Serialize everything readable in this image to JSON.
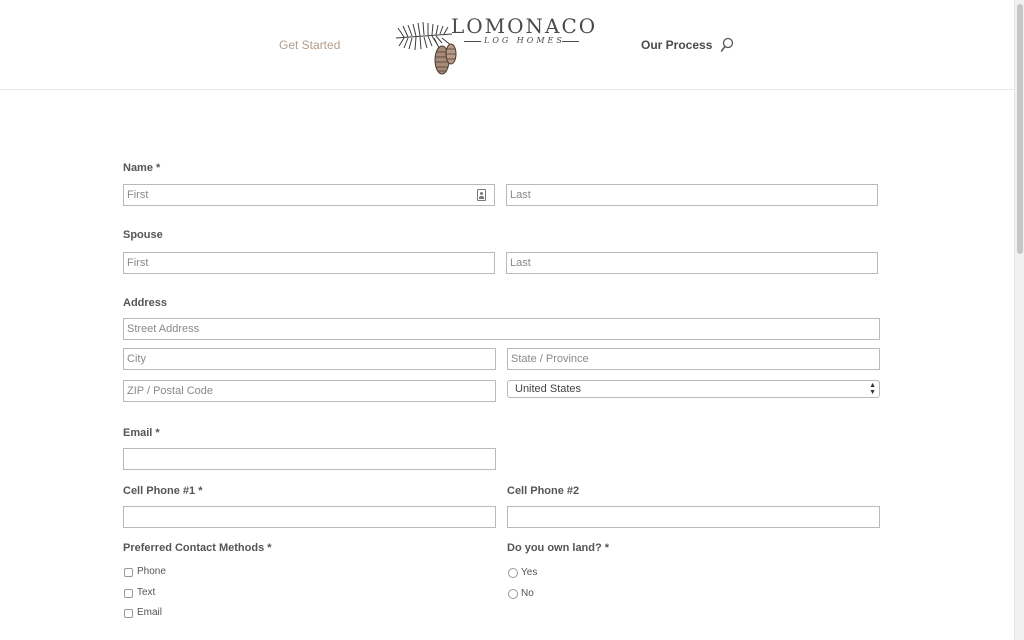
{
  "header": {
    "nav_left": "Get Started",
    "nav_right": "Our Process",
    "logo_title": "LOMONACO",
    "logo_sub": "LOG HOMES",
    "search_icon": "magnifier"
  },
  "form": {
    "name": {
      "label": "Name *",
      "first_placeholder": "First",
      "last_placeholder": "Last"
    },
    "spouse": {
      "label": "Spouse",
      "first_placeholder": "First",
      "last_placeholder": "Last"
    },
    "address": {
      "label": "Address",
      "street_placeholder": "Street Address",
      "city_placeholder": "City",
      "state_placeholder": "State / Province",
      "zip_placeholder": "ZIP / Postal Code",
      "country_selected": "United States"
    },
    "email": {
      "label": "Email *",
      "value": ""
    },
    "cell1": {
      "label": "Cell Phone #1 *",
      "value": ""
    },
    "cell2": {
      "label": "Cell Phone #2",
      "value": ""
    },
    "contact_methods": {
      "label": "Preferred Contact Methods *",
      "options": [
        "Phone",
        "Text",
        "Email"
      ]
    },
    "own_land": {
      "label": "Do you own land? *",
      "options": [
        "Yes",
        "No"
      ]
    }
  },
  "colors": {
    "nav_accent": "#b59c8a",
    "text_dark": "#4a4a4a",
    "border": "#b9b9b9"
  }
}
